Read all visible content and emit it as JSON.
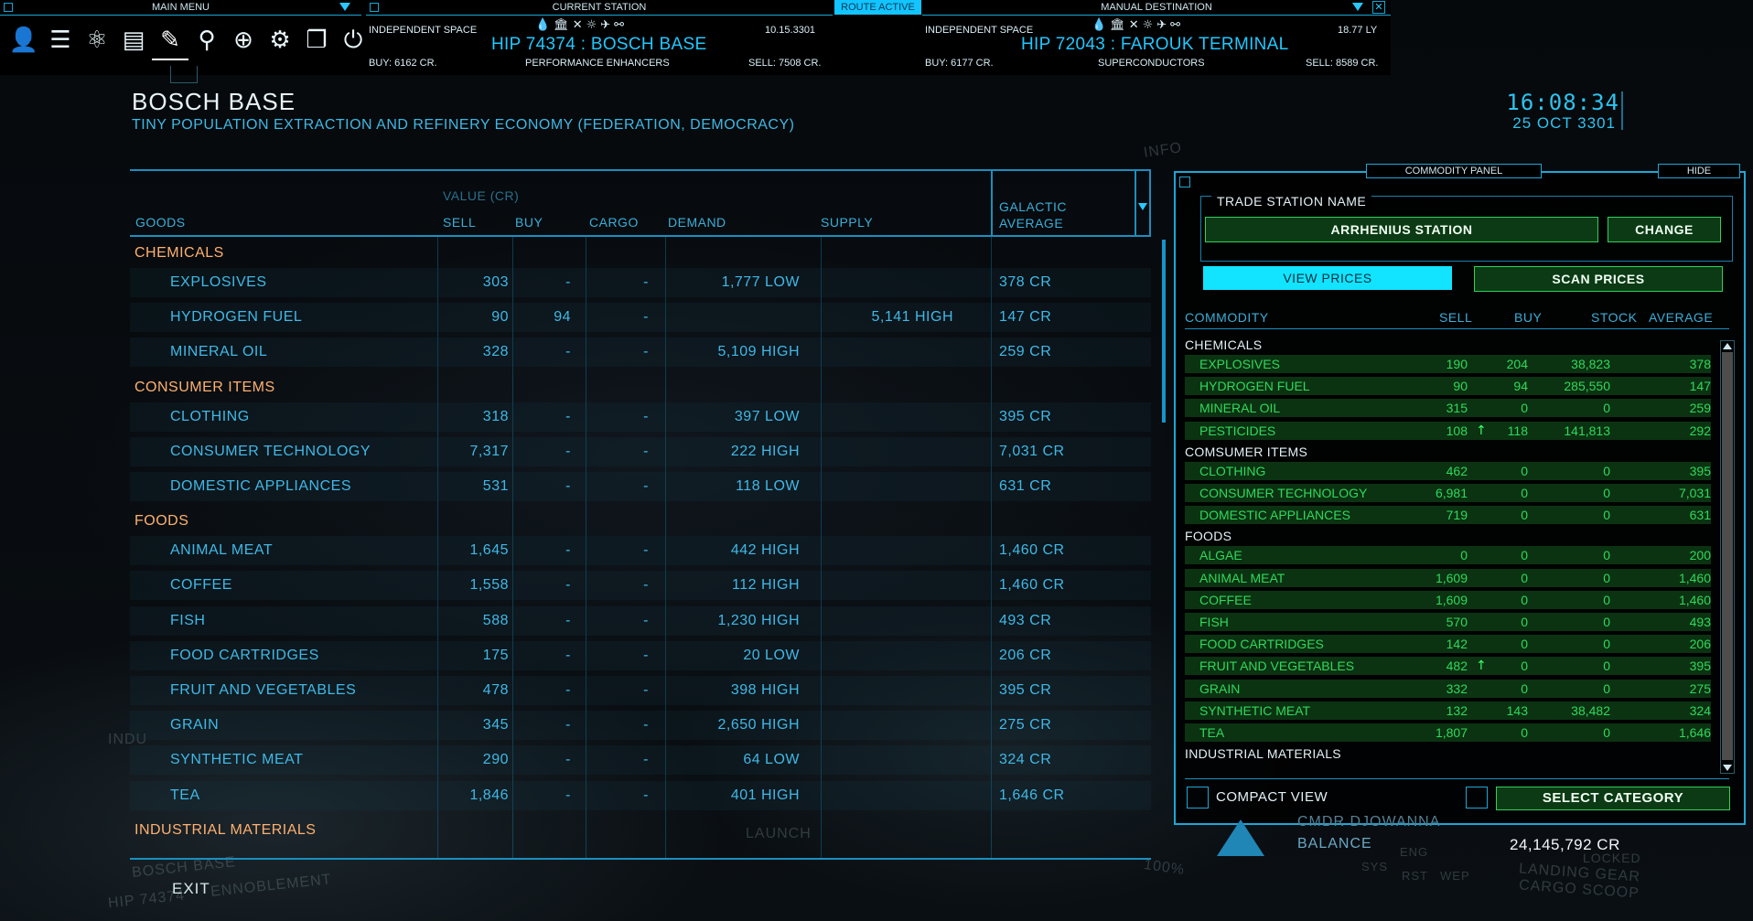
{
  "topbar": {
    "main_menu": "MAIN MENU",
    "current_station_tab": "CURRENT STATION",
    "route_active": "ROUTE ACTIVE",
    "manual_destination": "MANUAL DESTINATION",
    "current": {
      "region": "INDEPENDENT SPACE",
      "name": "HIP 74374 : BOSCH BASE",
      "version": "10.15.3301",
      "buy": "BUY: 6162 CR.",
      "commodity": "PERFORMANCE ENHANCERS",
      "sell": "SELL: 7508 CR."
    },
    "destination": {
      "region": "INDEPENDENT SPACE",
      "name": "HIP 72043 : FAROUK TERMINAL",
      "distance": "18.77 LY",
      "buy": "BUY: 6177 CR.",
      "commodity": "SUPERCONDUCTORS",
      "sell": "SELL: 8589 CR."
    },
    "menu_icons": [
      "commander-icon",
      "journal-icon",
      "galaxy-map-icon",
      "transactions-icon",
      "trade-icon",
      "search-icon",
      "navigation-icon",
      "settings-icon",
      "panels-icon",
      "power-icon"
    ],
    "service_icons": "💧🏛✕☼✈⚯"
  },
  "station": {
    "title": "BOSCH BASE",
    "subtitle": "TINY POPULATION EXTRACTION AND REFINERY ECONOMY (FEDERATION, DEMOCRACY)"
  },
  "clock": {
    "time": "16:08:34",
    "date": "25 OCT 3301"
  },
  "main_table": {
    "value_group": "VALUE (CR)",
    "headers": {
      "goods": "GOODS",
      "sell": "SELL",
      "buy": "BUY",
      "cargo": "CARGO",
      "demand": "DEMAND",
      "supply": "SUPPLY",
      "galactic1": "GALACTIC",
      "galactic2": "AVERAGE"
    },
    "sections": [
      {
        "category": "CHEMICALS",
        "rows": [
          {
            "name": "EXPLOSIVES",
            "sell": "303",
            "buy": "-",
            "cargo": "-",
            "demand": "1,777  LOW",
            "supply": "",
            "avg": "378 CR"
          },
          {
            "name": "HYDROGEN FUEL",
            "sell": "90",
            "buy": "94",
            "cargo": "-",
            "demand": "",
            "supply": "5,141  HIGH",
            "avg": "147 CR"
          },
          {
            "name": "MINERAL OIL",
            "sell": "328",
            "buy": "-",
            "cargo": "-",
            "demand": "5,109  HIGH",
            "supply": "",
            "avg": "259 CR"
          }
        ]
      },
      {
        "category": "CONSUMER ITEMS",
        "rows": [
          {
            "name": "CLOTHING",
            "sell": "318",
            "buy": "-",
            "cargo": "-",
            "demand": "397  LOW",
            "supply": "",
            "avg": "395 CR"
          },
          {
            "name": "CONSUMER TECHNOLOGY",
            "sell": "7,317",
            "buy": "-",
            "cargo": "-",
            "demand": "222  HIGH",
            "supply": "",
            "avg": "7,031 CR"
          },
          {
            "name": "DOMESTIC APPLIANCES",
            "sell": "531",
            "buy": "-",
            "cargo": "-",
            "demand": "118  LOW",
            "supply": "",
            "avg": "631 CR"
          }
        ]
      },
      {
        "category": "FOODS",
        "rows": [
          {
            "name": "ANIMAL MEAT",
            "sell": "1,645",
            "buy": "-",
            "cargo": "-",
            "demand": "442  HIGH",
            "supply": "",
            "avg": "1,460 CR"
          },
          {
            "name": "COFFEE",
            "sell": "1,558",
            "buy": "-",
            "cargo": "-",
            "demand": "112  HIGH",
            "supply": "",
            "avg": "1,460 CR"
          },
          {
            "name": "FISH",
            "sell": "588",
            "buy": "-",
            "cargo": "-",
            "demand": "1,230  HIGH",
            "supply": "",
            "avg": "493 CR"
          },
          {
            "name": "FOOD CARTRIDGES",
            "sell": "175",
            "buy": "-",
            "cargo": "-",
            "demand": "20  LOW",
            "supply": "",
            "avg": "206 CR"
          },
          {
            "name": "FRUIT AND VEGETABLES",
            "sell": "478",
            "buy": "-",
            "cargo": "-",
            "demand": "398  HIGH",
            "supply": "",
            "avg": "395 CR"
          },
          {
            "name": "GRAIN",
            "sell": "345",
            "buy": "-",
            "cargo": "-",
            "demand": "2,650  HIGH",
            "supply": "",
            "avg": "275 CR"
          },
          {
            "name": "SYNTHETIC MEAT",
            "sell": "290",
            "buy": "-",
            "cargo": "-",
            "demand": "64  LOW",
            "supply": "",
            "avg": "324 CR"
          },
          {
            "name": "TEA",
            "sell": "1,846",
            "buy": "-",
            "cargo": "-",
            "demand": "401  HIGH",
            "supply": "",
            "avg": "1,646 CR"
          }
        ]
      },
      {
        "category": "INDUSTRIAL MATERIALS",
        "rows": []
      }
    ]
  },
  "commodity_panel": {
    "title": "COMMODITY PANEL",
    "hide": "HIDE",
    "trade_station_label": "TRADE STATION NAME",
    "station_name": "ARRHENIUS STATION",
    "change": "CHANGE",
    "view_prices": "VIEW PRICES",
    "scan_prices": "SCAN PRICES",
    "headers": {
      "commodity": "COMMODITY",
      "sell": "SELL",
      "buy": "BUY",
      "stock": "STOCK",
      "average": "AVERAGE"
    },
    "sections": [
      {
        "category": "CHEMICALS",
        "rows": [
          {
            "name": "EXPLOSIVES",
            "sell": "190",
            "buy": "204",
            "stock": "38,823",
            "avg": "378",
            "up": ""
          },
          {
            "name": "HYDROGEN FUEL",
            "sell": "90",
            "buy": "94",
            "stock": "285,550",
            "avg": "147",
            "up": ""
          },
          {
            "name": "MINERAL OIL",
            "sell": "315",
            "buy": "0",
            "stock": "0",
            "avg": "259",
            "up": ""
          },
          {
            "name": "PESTICIDES",
            "sell": "108",
            "buy": "118",
            "stock": "141,813",
            "avg": "292",
            "up": "↑"
          }
        ]
      },
      {
        "category": "COMSUMER ITEMS",
        "rows": [
          {
            "name": "CLOTHING",
            "sell": "462",
            "buy": "0",
            "stock": "0",
            "avg": "395",
            "up": ""
          },
          {
            "name": "CONSUMER TECHNOLOGY",
            "sell": "6,981",
            "buy": "0",
            "stock": "0",
            "avg": "7,031",
            "up": ""
          },
          {
            "name": "DOMESTIC APPLIANCES",
            "sell": "719",
            "buy": "0",
            "stock": "0",
            "avg": "631",
            "up": ""
          }
        ]
      },
      {
        "category": "FOODS",
        "rows": [
          {
            "name": "ALGAE",
            "sell": "0",
            "buy": "0",
            "stock": "0",
            "avg": "200",
            "up": ""
          },
          {
            "name": "ANIMAL MEAT",
            "sell": "1,609",
            "buy": "0",
            "stock": "0",
            "avg": "1,460",
            "up": ""
          },
          {
            "name": "COFFEE",
            "sell": "1,609",
            "buy": "0",
            "stock": "0",
            "avg": "1,460",
            "up": ""
          },
          {
            "name": "FISH",
            "sell": "570",
            "buy": "0",
            "stock": "0",
            "avg": "493",
            "up": ""
          },
          {
            "name": "FOOD CARTRIDGES",
            "sell": "142",
            "buy": "0",
            "stock": "0",
            "avg": "206",
            "up": ""
          },
          {
            "name": "FRUIT AND VEGETABLES",
            "sell": "482",
            "buy": "0",
            "stock": "0",
            "avg": "395",
            "up": "↑"
          },
          {
            "name": "GRAIN",
            "sell": "332",
            "buy": "0",
            "stock": "0",
            "avg": "275",
            "up": ""
          },
          {
            "name": "SYNTHETIC MEAT",
            "sell": "132",
            "buy": "143",
            "stock": "38,482",
            "avg": "324",
            "up": ""
          },
          {
            "name": "TEA",
            "sell": "1,807",
            "buy": "0",
            "stock": "0",
            "avg": "1,646",
            "up": ""
          }
        ]
      },
      {
        "category": "INDUSTRIAL MATERIALS",
        "rows": []
      }
    ],
    "compact_view": "COMPACT VIEW",
    "select_category": "SELECT CATEGORY"
  },
  "cockpit": {
    "exit": "EXIT",
    "commander": "CMDR DJOWANNA",
    "balance_label": "BALANCE",
    "balance_value": "24,145,792 CR",
    "ghost_left1": "BOSCH BASE",
    "ghost_left2": "HIP 74374",
    "ghost_left3": "ENNOBLEMENT",
    "ghost_ind": "INDU",
    "ghost_launch": "LAUNCH",
    "ghost_info": "INFO",
    "ghost_percent": "100%",
    "ghost_sys": "SYS",
    "ghost_eng": "ENG",
    "ghost_wep": "WEP",
    "ghost_rst": "RST",
    "ghost_landing": "LANDING GEAR",
    "ghost_cargo": "CARGO SCOOP",
    "ghost_locked": "LOCKED"
  },
  "colors": {
    "accent": "#1ea6d6",
    "text_blue": "#40b8e6",
    "category": "#ffb070",
    "panel_green": "#30d85a",
    "route_active": "#12c4ff"
  }
}
